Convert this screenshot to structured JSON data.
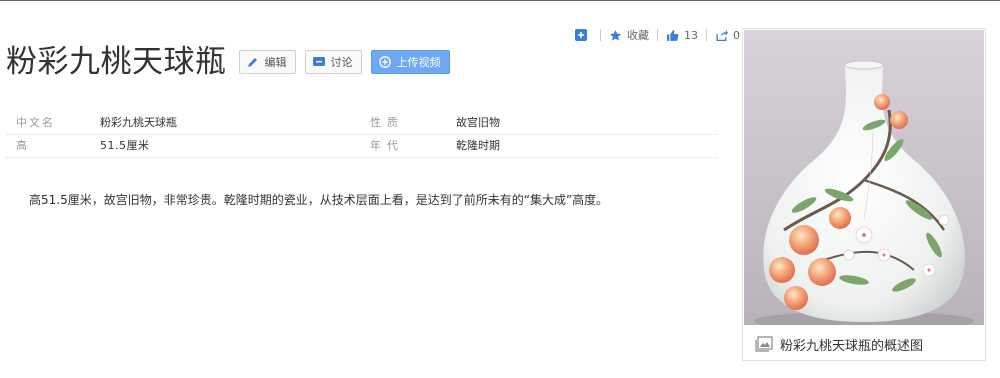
{
  "entry": {
    "title": "粉彩九桃天球瓶",
    "buttons": {
      "edit": "编辑",
      "discuss": "讨论",
      "upload_video": "上传视频"
    }
  },
  "share": {
    "collect": "收藏",
    "likes": "13",
    "shares": "0"
  },
  "basic_info": [
    {
      "k1": "中文名",
      "v1": "粉彩九桃天球瓶",
      "k2": "性质",
      "v2": "故宫旧物"
    },
    {
      "k1": "高",
      "v1": "51.5厘米",
      "k2": "年代",
      "v2": "乾隆时期"
    }
  ],
  "paragraph": "高51.5厘米，故宫旧物，非常珍贵。乾隆时期的瓷业，从技术层面上看，是达到了前所未有的“集大成”高度。",
  "album": {
    "caption": "粉彩九桃天球瓶的概述图"
  },
  "colors": {
    "accent": "#3b7dd8",
    "primary_button": "#6ea8f1"
  },
  "icons": {
    "edit": "pencil-icon",
    "discuss": "chat-icon",
    "upload": "plus-circle-icon",
    "add": "plus-box-icon",
    "collect": "star-icon",
    "like": "thumbs-up-icon",
    "share": "share-icon",
    "album": "gallery-icon"
  }
}
